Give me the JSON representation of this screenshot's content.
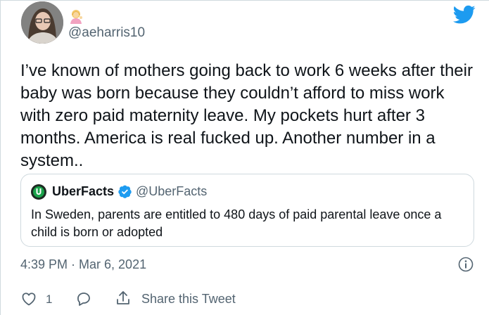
{
  "author": {
    "handle": "@aeharris10",
    "avatar_icon": "profile-photo",
    "emoji_icon": "woman-tipping-hand-emoji"
  },
  "tweet": {
    "text": "I’ve known of mothers going back to work 6 weeks after their baby was born because they couldn’t afford to miss work with zero paid maternity leave. My pockets hurt after 3 months.  America is real fucked up. Another number in a system..",
    "timestamp": "4:39 PM · Mar 6, 2021"
  },
  "quoted_tweet": {
    "name": "UberFacts",
    "handle": "@UberFacts",
    "verified": true,
    "text": "In Sweden, parents are entitled to 480 days of paid parental leave once a child is born or adopted"
  },
  "actions": {
    "like_count": "1",
    "share_label": "Share this Tweet"
  },
  "colors": {
    "brand_blue": "#1d9bf0",
    "secondary_text": "#536471",
    "border": "#cfd9de",
    "uberfacts_green": "#1aa34a"
  }
}
